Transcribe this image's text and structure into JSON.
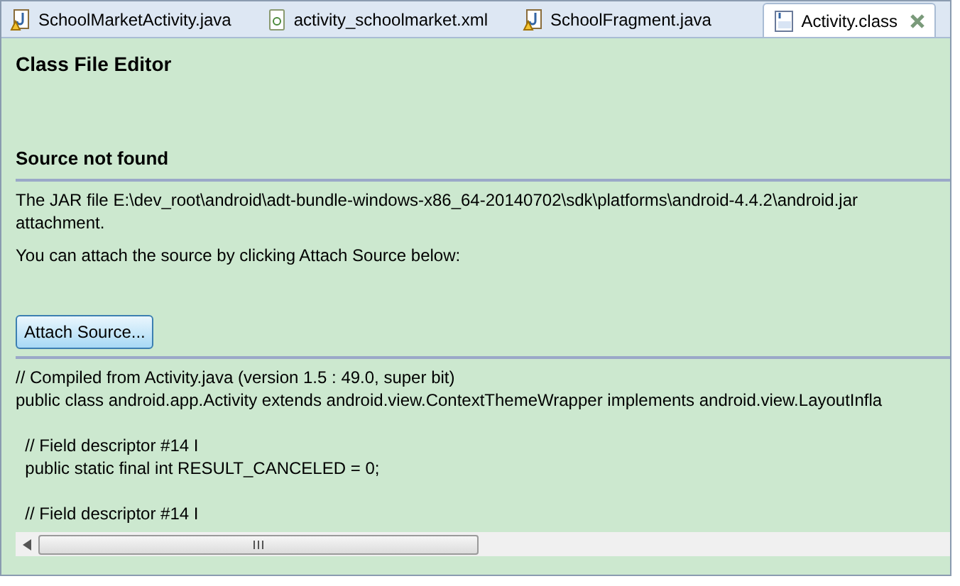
{
  "tabs": [
    {
      "label": "SchoolMarketActivity.java",
      "kind": "java",
      "selected": false
    },
    {
      "label": "activity_schoolmarket.xml",
      "kind": "xml",
      "selected": false
    },
    {
      "label": "SchoolFragment.java",
      "kind": "java",
      "selected": false
    },
    {
      "label": "Activity.class",
      "kind": "class",
      "selected": true
    }
  ],
  "editor": {
    "title": "Class File Editor",
    "section_title": "Source not found",
    "message": [
      "The JAR file E:\\dev_root\\android\\adt-bundle-windows-x86_64-20140702\\sdk\\platforms\\android-4.4.2\\android.jar",
      "attachment."
    ],
    "hint": "You can attach the source by clicking Attach Source below:",
    "button": "Attach Source...",
    "code_blocks": [
      [
        "// Compiled from Activity.java (version 1.5 : 49.0, super bit)",
        "public class android.app.Activity extends android.view.ContextThemeWrapper implements android.view.LayoutInfla"
      ],
      [
        "  // Field descriptor #14 I",
        "  public static final int RESULT_CANCELED = 0;"
      ],
      [
        "  // Field descriptor #14 I"
      ]
    ]
  }
}
